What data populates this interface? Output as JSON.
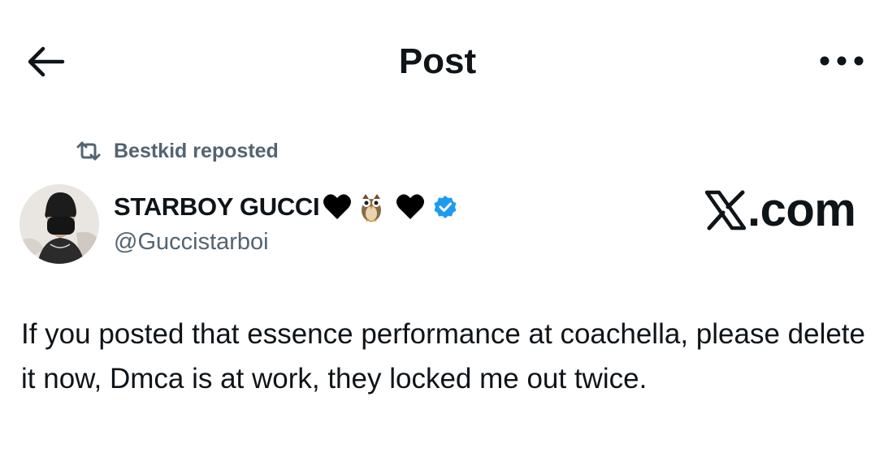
{
  "header": {
    "title": "Post",
    "back_icon": "arrow-left-icon",
    "more_icon": "more-horizontal-icon"
  },
  "repost": {
    "text": "Bestkid reposted",
    "icon": "repost-icon"
  },
  "author": {
    "display_name": "STARBOY GUCCI",
    "emojis": [
      "black-heart",
      "owl",
      "black-heart"
    ],
    "verified": true,
    "verified_color": "#1d9bf0",
    "handle": "@Guccistarboi"
  },
  "watermark": {
    "logo": "x-logo-icon",
    "text": ".com"
  },
  "post": {
    "text": "If you posted that essence performance at coachella, please delete it now, Dmca is at work, they locked me out twice."
  },
  "colors": {
    "text_primary": "#0f1419",
    "text_secondary": "#536471",
    "background": "#ffffff"
  }
}
